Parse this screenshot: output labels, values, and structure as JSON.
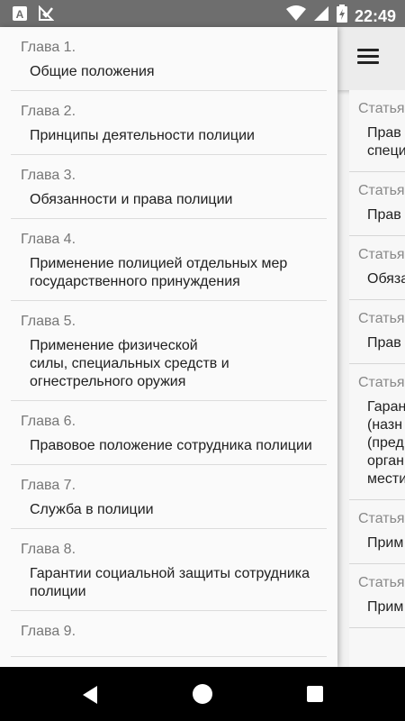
{
  "status_bar": {
    "time": "22:49",
    "icons": [
      "a-notification-icon",
      "check-notification-icon",
      "wifi-icon",
      "signal-icon",
      "battery-icon"
    ]
  },
  "drawer": {
    "chapters": [
      {
        "label": "Глава 1.",
        "title": "Общие положения"
      },
      {
        "label": "Глава 2.",
        "title": "Принципы деятельности полиции"
      },
      {
        "label": "Глава 3.",
        "title": "Обязанности и права полиции"
      },
      {
        "label": "Глава 4.",
        "title": "Применение полицией отдельных мер государственного принуждения"
      },
      {
        "label": "Глава 5.",
        "title": "Применение физической\nсилы, специальных средств и огнестрельного оружия"
      },
      {
        "label": "Глава 6.",
        "title": "Правовое положение сотрудника полиции"
      },
      {
        "label": "Глава 7.",
        "title": "Служба в полиции"
      },
      {
        "label": "Глава 8.",
        "title": "Гарантии социальной защиты сотрудника полиции"
      },
      {
        "label": "Глава 9.",
        "title": ""
      }
    ]
  },
  "main": {
    "articles": [
      {
        "label": "Статья",
        "text": "Прав\nспеци"
      },
      {
        "label": "Статья",
        "text": "Прав"
      },
      {
        "label": "Статья",
        "text": "Обяза"
      },
      {
        "label": "Статья",
        "text": "Прав"
      },
      {
        "label": "Статья",
        "text": "Гаран\n(назн\n(пред\nорган\nмести"
      },
      {
        "label": "Статья",
        "text": "Прим"
      },
      {
        "label": "Статья",
        "text": "Прим"
      }
    ]
  }
}
